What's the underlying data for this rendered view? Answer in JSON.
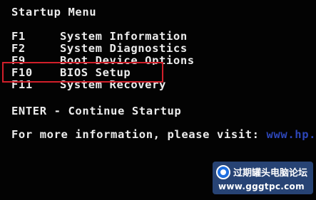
{
  "screen": {
    "title": "Startup Menu",
    "menu": [
      {
        "key": "F1",
        "label": "System Information"
      },
      {
        "key": "F2",
        "label": "System Diagnostics"
      },
      {
        "key": "F9",
        "label": "Boot Device Options"
      },
      {
        "key": "F10",
        "label": "BIOS Setup"
      },
      {
        "key": "F11",
        "label": "System Recovery"
      }
    ],
    "enter_line": "ENTER - Continue Startup",
    "visit_text": "For more information, please visit: ",
    "visit_url": "www.hp.c"
  },
  "highlight": {
    "target_key": "F10",
    "color": "#d21f2a"
  },
  "watermark": {
    "title": "过期罐头电脑论坛",
    "url": "www.gggtpc.com"
  },
  "colors": {
    "background": "#030303",
    "text": "#ececec",
    "link": "#2d46b8"
  }
}
